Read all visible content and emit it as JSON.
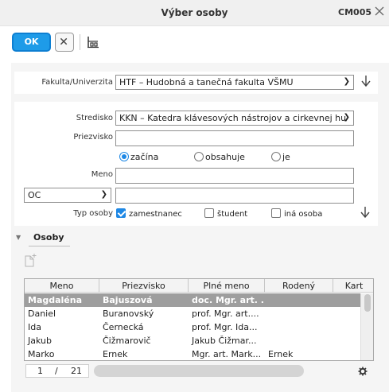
{
  "window": {
    "title": "Výber osoby",
    "code": "CM005"
  },
  "toolbar": {
    "ok_label": "OK"
  },
  "form": {
    "fakulta_label": "Fakulta/Univerzita",
    "fakulta_value": "HTF – Hudobná a tanečná fakulta VŠMU",
    "stredisko_label": "Stredisko",
    "stredisko_value": "KKN – Katedra klávesových nástrojov a cirkevnej hu",
    "priezvisko_label": "Priezvisko",
    "priezvisko_value": "",
    "match_options": [
      {
        "label": "začína",
        "selected": true
      },
      {
        "label": "obsahuje",
        "selected": false
      },
      {
        "label": "je",
        "selected": false
      }
    ],
    "meno_label": "Meno",
    "meno_value": "",
    "oc_select": "OC",
    "oc_value": "",
    "typ_label": "Typ osoby",
    "typ_options": [
      {
        "label": "zamestnanec",
        "checked": true
      },
      {
        "label": "študent",
        "checked": false
      },
      {
        "label": "iná osoba",
        "checked": false
      }
    ]
  },
  "osoby": {
    "title": "Osoby",
    "columns": [
      "Meno",
      "Priezvisko",
      "Plné meno",
      "Rodený",
      "Kart"
    ],
    "rows": [
      [
        "Magdaléna",
        "Bajuszová",
        "doc. Mgr. art. ...",
        "",
        ""
      ],
      [
        "Daniel",
        "Buranovský",
        "prof. Mgr. art....",
        "",
        ""
      ],
      [
        "Ida",
        "Černecká",
        "prof. Mgr. Ida...",
        "",
        ""
      ],
      [
        "Jakub",
        "Čižmarovič",
        "Jakub Čižmar...",
        "",
        ""
      ],
      [
        "Marko",
        "Ernek",
        "Mgr. art. Mark...",
        "Ernek",
        ""
      ]
    ],
    "selected_row": 0,
    "pager": {
      "current": "1",
      "separator": "/",
      "total": "21"
    }
  },
  "colors": {
    "accent": "#1e9be8",
    "selected_row": "#9e9e9e",
    "panel": "#f5f5f5"
  },
  "icons": {
    "close": "close-x-icon",
    "cancel": "x-icon",
    "tree": "hierarchy-icon",
    "refresh": "arrow-down-icon",
    "new": "new-record-icon",
    "settings": "gear-icon"
  }
}
